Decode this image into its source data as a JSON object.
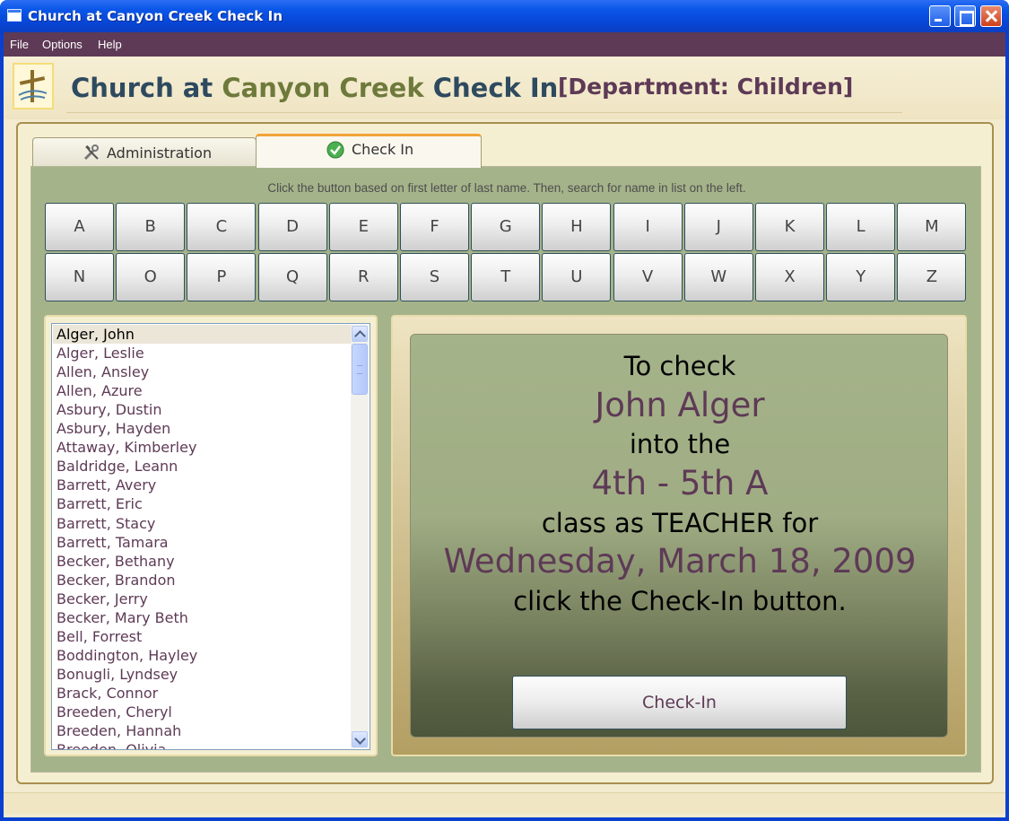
{
  "window": {
    "title": "Church at Canyon Creek Check In"
  },
  "menu": {
    "items": [
      "File",
      "Options",
      "Help"
    ]
  },
  "header": {
    "title_part1": "Church at ",
    "title_part2": "Canyon Creek",
    "title_part3": " Check In",
    "department": "[Department: Children]"
  },
  "tabs": [
    {
      "label": "Administration",
      "icon": "tools-icon",
      "selected": false
    },
    {
      "label": "Check In",
      "icon": "checkmark-icon",
      "selected": true
    }
  ],
  "instructions": "Click the button based on first letter of last name. Then, search for name in list on the left.",
  "letters_row1": [
    "A",
    "B",
    "C",
    "D",
    "E",
    "F",
    "G",
    "H",
    "I",
    "J",
    "K",
    "L",
    "M"
  ],
  "letters_row2": [
    "N",
    "O",
    "P",
    "Q",
    "R",
    "S",
    "T",
    "U",
    "V",
    "W",
    "X",
    "Y",
    "Z"
  ],
  "names": [
    "Alger, John",
    "Alger, Leslie",
    "Allen, Ansley",
    "Allen, Azure",
    "Asbury, Dustin",
    "Asbury, Hayden",
    "Attaway, Kimberley",
    "Baldridge, Leann",
    "Barrett, Avery",
    "Barrett, Eric",
    "Barrett, Stacy",
    "Barrett, Tamara",
    "Becker, Bethany",
    "Becker, Brandon",
    "Becker, Jerry",
    "Becker, Mary Beth",
    "Bell, Forrest",
    "Boddington, Hayley",
    "Bonugli, Lyndsey",
    "Brack, Connor",
    "Breeden, Cheryl",
    "Breeden, Hannah",
    "Breeden, Olivia"
  ],
  "selected_name_index": 0,
  "checkin": {
    "line1": "To check",
    "person": "John  Alger",
    "line2": "into the",
    "class_name": "4th - 5th A",
    "line3": "class as TEACHER for",
    "date": "Wednesday, March 18, 2009",
    "line4": "click the Check-In button.",
    "button_label": "Check-In"
  },
  "colors": {
    "accent_purple": "#5e3a56",
    "title_blue": "#2e4a5f",
    "title_olive": "#6e7a3b",
    "panel_green": "#a5b38a",
    "tab_highlight": "#f0a43a"
  }
}
